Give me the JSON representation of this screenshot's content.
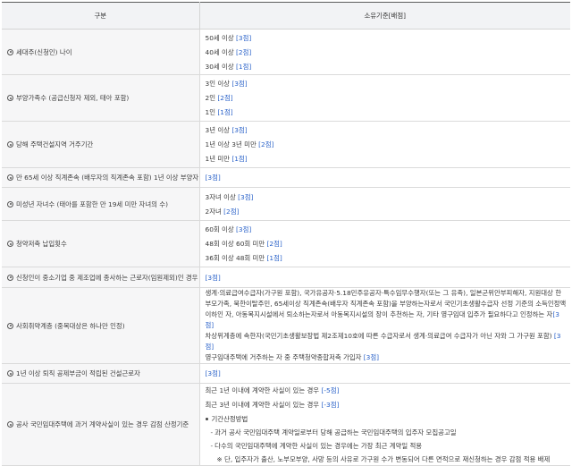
{
  "header": {
    "col1": "구분",
    "col2": "소유기준[배점]"
  },
  "rows": [
    {
      "criterion": "세대주(신청인) 나이",
      "items": [
        {
          "text": "50세 이상 ",
          "points": "[3점]"
        },
        {
          "text": "40세 이상 ",
          "points": "[2점]"
        },
        {
          "text": "30세 이상 ",
          "points": "[1점]"
        }
      ]
    },
    {
      "criterion": "부양가족수 (공급신청자 제외, 태아 포함)",
      "items": [
        {
          "text": "3인 이상 ",
          "points": "[3점]"
        },
        {
          "text": "2인 ",
          "points": "[2점]"
        },
        {
          "text": "1인 ",
          "points": "[1점]"
        }
      ]
    },
    {
      "criterion": "당해 주택건설지역 거주기간",
      "items": [
        {
          "text": "3년 이상 ",
          "points": "[3점]"
        },
        {
          "text": "1년 이상 3년 미만 ",
          "points": "[2점]"
        },
        {
          "text": "1년 미만 ",
          "points": "[1점]"
        }
      ]
    },
    {
      "criterion": "만 65세 이상 직계존속 (배우자의 직계존속 포함) 1년 이상 부양자",
      "items": [
        {
          "text": "",
          "points": "[3점]"
        }
      ]
    },
    {
      "criterion": "미성년 자녀수 (태아를 포함한 만 19세 미만 자녀의 수)",
      "items": [
        {
          "text": "3자녀 이상 ",
          "points": "[3점]"
        },
        {
          "text": "2자녀 ",
          "points": "[2점]"
        }
      ]
    },
    {
      "criterion": "청약저축 납입횟수",
      "items": [
        {
          "text": "60회 이상 ",
          "points": "[3점]"
        },
        {
          "text": "48회 이상 60회 미만 ",
          "points": "[2점]"
        },
        {
          "text": "36회 이상 48회 미만 ",
          "points": "[1점]"
        }
      ]
    },
    {
      "criterion": "신청인이 중소기업 중 제조업에 종사하는 근로자(임원제외)인 경우",
      "items": [
        {
          "text": "",
          "points": "[3점]"
        }
      ]
    },
    {
      "criterion": "사회취약계층 (중복대상은 하나만 인정)",
      "para1": "생계·의료급여수급자(가구원 포함), 국가유공자·5.18민주유공자·특수임무수행자(또는 그 유족), 일본군위안부피해자, 지원대상 한부모가족, 북한이탈주민, 65세이상 직계존속(배우자 직계존속 포함)을 부양하는자로서 국민기초생활수급자 선정 기준의 소득인정액 이하인 자, 아동복지시설에서 퇴소하는자로서 아동복지시설의 장이 추천하는 자, 기타 영구임대 입주가 필요하다고 인정하는 자",
      "para1_points": "[3점]",
      "para2": "차상위계층에 속한자(국민기초생활보장법 제2조제10호에 따른 수급자로서 생계·의료급여 수급자가 아닌 자와 그 가구원 포함) ",
      "para2_points": "[3점]",
      "para3": "영구임대주택에 거주하는 자 중 주택청약종합저축 가입자 ",
      "para3_points": "[3점]"
    },
    {
      "criterion": "1년 이상 퇴직 공제부금이 적립된 건설근로자",
      "items": [
        {
          "text": "",
          "points": "[3점]"
        }
      ]
    },
    {
      "criterion": "공사 국민임대주택에 과거 계약사실이 있는 경우 감점 산정기준",
      "items": [
        {
          "text": "최근 1년 이내에 계약한 사실이 있는 경우 ",
          "points": "[-5점]"
        },
        {
          "text": "최근 3년 이내에 계약한 사실이 있는 경우 ",
          "points": "[-3점]"
        }
      ],
      "method_title": "기간산정방법",
      "method_1": "과거 공사 국민임대주택 계약일로부터 당해 공급하는 국민임대주택의 입주자 모집공고일",
      "method_2": "다수의 국민임대주택에 계약한 사실이 있는 경우에는 가장 최근 계약일 적용",
      "note": "※ 단, 입주자가 출산, 노부모부양, 사망 등의 사유로 가구원 수가 변동되어 다른 면적으로 재신청하는 경우 감점 적용 배제"
    }
  ]
}
